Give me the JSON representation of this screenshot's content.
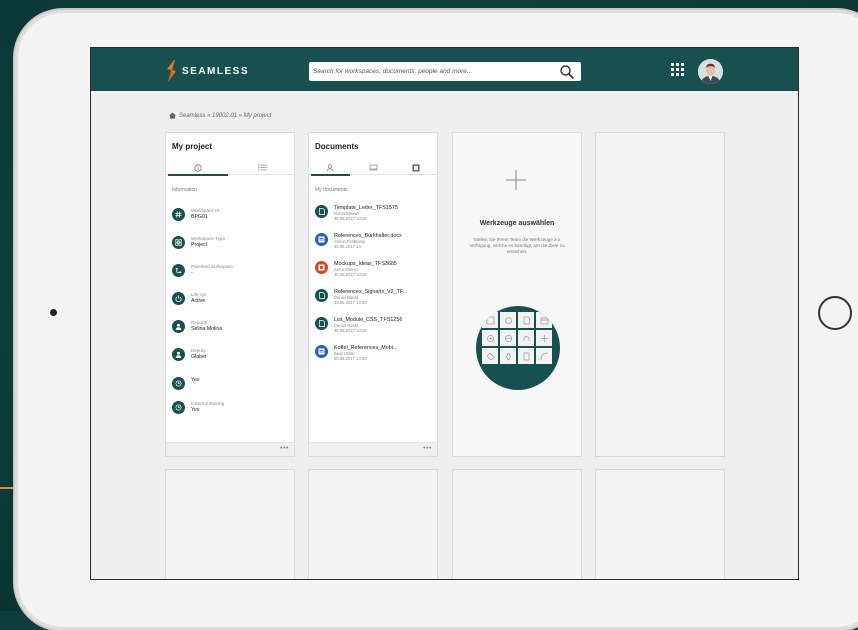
{
  "app": {
    "brand": "SEAMLESS"
  },
  "search": {
    "placeholder": "Search for workspaces, documents, people and more..."
  },
  "breadcrumb": {
    "text": "Seamless » 19002.01 » My project"
  },
  "project_card": {
    "title": "My project",
    "section": "Information",
    "rows": [
      {
        "label": "Workspace ID",
        "value": "BPG01",
        "icon": "hash-icon"
      },
      {
        "label": "Workspace Type",
        "value": "Project",
        "icon": "grid-icon"
      },
      {
        "label": "Parented workspace",
        "value": "-",
        "icon": "hierarchy-icon"
      },
      {
        "label": "Life cyc",
        "value": "Active",
        "icon": "power-icon"
      },
      {
        "label": "Reports",
        "value": "Selina Molina",
        "icon": "person-icon"
      },
      {
        "label": "Deputy",
        "value": "Glaber",
        "icon": "person-icon"
      },
      {
        "label": "",
        "value": "Yes",
        "icon": "clock-icon"
      },
      {
        "label": "External sharing",
        "value": "Yes",
        "icon": "clock-icon"
      }
    ]
  },
  "documents_card": {
    "title": "Documents",
    "section": "My documents",
    "docs": [
      {
        "name": "Template_Letter_TFS1575",
        "author": "Robin Steiner",
        "date": "30.05.2017 14:20",
        "color": "#17504f",
        "icon": "document-icon"
      },
      {
        "name": "References_Burkhalter.docx",
        "author": "Simon Feldkamp",
        "date": "30.05.2017 14:",
        "color": "#2b5fb4",
        "icon": "word-icon"
      },
      {
        "name": "Mockups_Ideas_TFS3685",
        "author": "Anna Steiner",
        "date": "30.05.2017 14:20",
        "color": "#d24726",
        "icon": "powerpoint-icon"
      },
      {
        "name": "References_Signaris_V2_TF...",
        "author": "Daniel Nüssli",
        "date": "30.05.2017 14:20",
        "color": "#17504f",
        "icon": "document-icon"
      },
      {
        "name": "List_Module_CSS_TFS1256",
        "author": "Daniel Nüssli",
        "date": "30.05.2017 14:20",
        "color": "#17504f",
        "icon": "document-icon"
      },
      {
        "name": "Koffel_References_Mobi...",
        "author": "Beat Utzler",
        "date": "30.05.2017 14:20",
        "color": "#2b5fb4",
        "icon": "word-icon"
      }
    ]
  },
  "tools_card": {
    "title": "Werkzeuge auswählen",
    "description": "Stellen Sie Ihrem Team die Werkzeuge zur Verfügung, welche es benötigt, um die Ziele zu erreichen."
  },
  "colors": {
    "brand": "#17504f",
    "accent": "#e8762b"
  }
}
